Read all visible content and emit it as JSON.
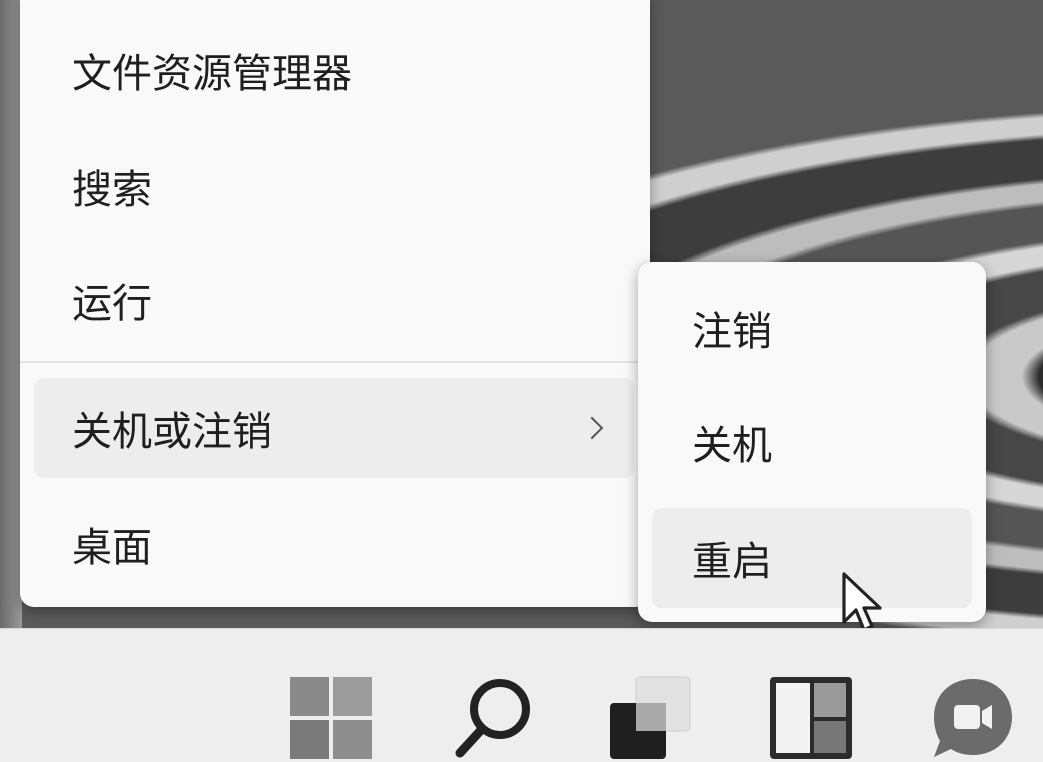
{
  "context_menu": {
    "items": [
      {
        "label": "文件资源管理器"
      },
      {
        "label": "搜索"
      },
      {
        "label": "运行"
      },
      {
        "label": "关机或注销",
        "has_submenu": true,
        "highlighted": true
      },
      {
        "label": "桌面"
      }
    ]
  },
  "submenu": {
    "items": [
      {
        "label": "注销"
      },
      {
        "label": "关机"
      },
      {
        "label": "重启",
        "highlighted": true
      }
    ]
  },
  "taskbar": {
    "icons": [
      "start-icon",
      "search-icon",
      "task-view-icon",
      "widgets-icon",
      "chat-icon"
    ]
  },
  "colors": {
    "menu_bg": "#f9f9f9",
    "highlight": "#ededed",
    "taskbar_bg": "#eeeeee"
  }
}
